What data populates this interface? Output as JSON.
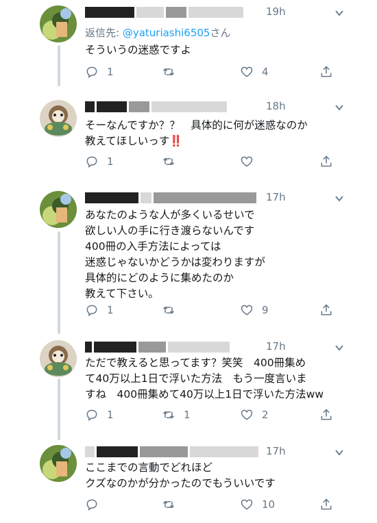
{
  "tweets": [
    {
      "time": "19h",
      "reply_prefix": "返信先: ",
      "reply_handle": "@yaturiashi6505",
      "reply_suffix": "さん",
      "text": "そういうの迷惑ですよ",
      "reply_count": "1",
      "retweet_count": "",
      "like_count": "4"
    },
    {
      "time": "18h",
      "text": "そーなんですか？？　具体的に何が迷惑なのか\n教えてほしいっす",
      "emoji": "‼️",
      "reply_count": "1",
      "retweet_count": "",
      "like_count": ""
    },
    {
      "time": "17h",
      "text": "あなたのような人が多くいるせいで\n欲しい人の手に行き渡らないんです\n400冊の入手方法によっては\n迷惑じゃないかどうかは変わりますが\n具体的にどのように集めたのか\n教えて下さい。",
      "reply_count": "1",
      "retweet_count": "",
      "like_count": "9"
    },
    {
      "time": "17h",
      "text": "ただで教えると思ってます？笑笑　400冊集め\nて40万以上1日で浮いた方法　もう一度言いま\nすね　400冊集めて40万以上1日で浮いた方法ww",
      "reply_count": "1",
      "retweet_count": "1",
      "like_count": "2"
    },
    {
      "time": "17h",
      "text": "ここまでの言動でどれほど\nクズなのかが分かったのでもういいです",
      "reply_count": "",
      "retweet_count": "",
      "like_count": "10"
    }
  ],
  "icons": {
    "reply": "reply-icon",
    "retweet": "retweet-icon",
    "like": "heart-icon",
    "share": "share-icon",
    "menu": "chevron-down-icon"
  },
  "colors": {
    "text": "#14171a",
    "secondary": "#657786",
    "link": "#1da1f2",
    "thread_line": "#cfd9de"
  }
}
